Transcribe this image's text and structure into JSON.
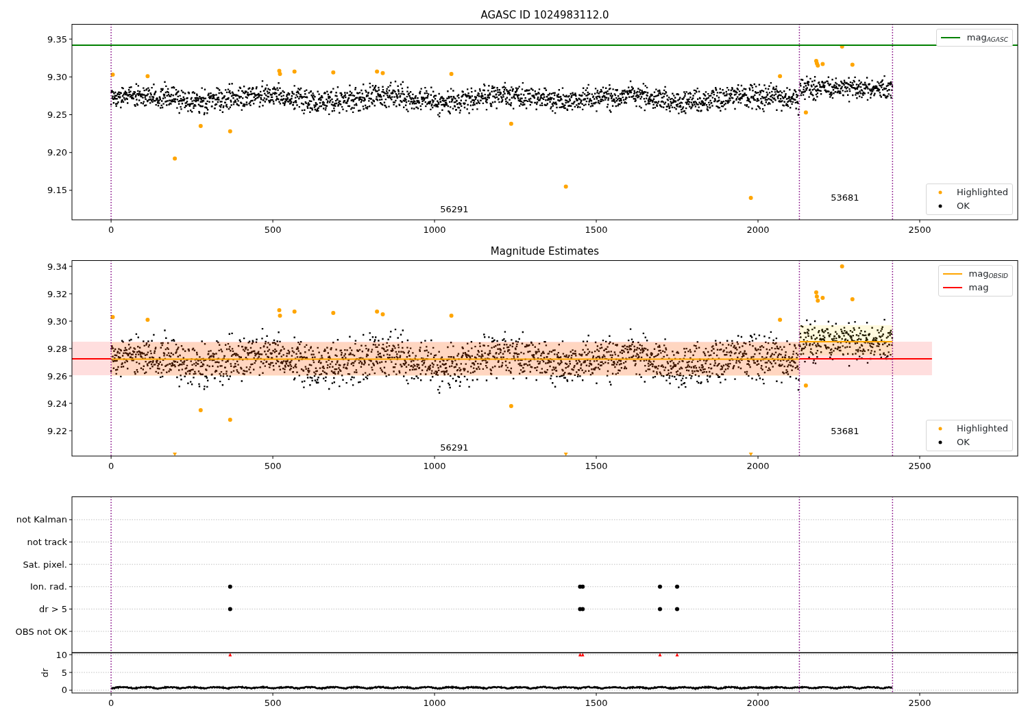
{
  "figure": {
    "panels": [
      {
        "title": "AGASC ID 1024983112.0",
        "legends": [
          {
            "items": [
              {
                "label": "mag$_{AGASC}$",
                "kind": "line",
                "color": "#008000"
              }
            ]
          },
          {
            "items": [
              {
                "label": "Highlighted",
                "kind": "dot",
                "color": "#ffa500"
              },
              {
                "label": "OK",
                "kind": "dot",
                "color": "#000000"
              }
            ]
          }
        ],
        "chart_data": {
          "type": "scatter",
          "xlim": [
            -121,
            2803
          ],
          "ylim": [
            9.111,
            9.37
          ],
          "xticks": [
            0,
            500,
            1000,
            1500,
            2000,
            2500
          ],
          "yticks": [
            {
              "value": 9.15,
              "label": "9.15"
            },
            {
              "value": 9.2,
              "label": "9.20"
            },
            {
              "value": 9.25,
              "label": "9.25"
            },
            {
              "value": 9.3,
              "label": "9.30"
            },
            {
              "value": 9.35,
              "label": "9.35"
            }
          ],
          "x": [
            5,
            113,
            197,
            277,
            368,
            520,
            522,
            567,
            687,
            822,
            840,
            1052,
            1237,
            1406,
            1978,
            2068,
            2148,
            2180,
            2182,
            2185,
            2200,
            2260,
            2292
          ],
          "series": [
            {
              "type": "scatter",
              "color": "#ffa500",
              "values": [
                9.303,
                9.301,
                9.192,
                9.235,
                9.228,
                9.308,
                9.304,
                9.307,
                9.306,
                9.307,
                9.305,
                9.304,
                9.238,
                9.155,
                9.14,
                9.301,
                9.253,
                9.321,
                9.318,
                9.315,
                9.317,
                9.34,
                9.316
              ]
            }
          ],
          "ref_lines": [
            {
              "axis": "y",
              "value": 9.342,
              "color": "#008000"
            },
            {
              "axis": "x",
              "value": 0,
              "color": "#800080"
            },
            {
              "axis": "x",
              "value": 2128,
              "color": "#800080"
            },
            {
              "axis": "x",
              "value": 2416,
              "color": "#800080"
            }
          ],
          "annotations": [
            "56291",
            "53681"
          ]
        }
      },
      {
        "title": "Magnitude Estimates",
        "legends": [
          {
            "items": [
              {
                "label": "mag$_{OBSID}$",
                "kind": "line",
                "color": "#ffa500"
              },
              {
                "label": "mag",
                "kind": "line",
                "color": "#ff0000"
              }
            ]
          },
          {
            "items": [
              {
                "label": "Highlighted",
                "kind": "dot",
                "color": "#ffa500"
              },
              {
                "label": "OK",
                "kind": "dot",
                "color": "#000000"
              }
            ]
          }
        ],
        "chart_data": {
          "type": "scatter",
          "xlim": [
            -121,
            2803
          ],
          "ylim": [
            9.2015,
            9.3445
          ],
          "xticks": [
            0,
            500,
            1000,
            1500,
            2000,
            2500
          ],
          "yticks": [
            {
              "value": 9.22,
              "label": "9.22"
            },
            {
              "value": 9.24,
              "label": "9.24"
            },
            {
              "value": 9.26,
              "label": "9.26"
            },
            {
              "value": 9.28,
              "label": "9.28"
            },
            {
              "value": 9.3,
              "label": "9.30"
            },
            {
              "value": 9.32,
              "label": "9.32"
            },
            {
              "value": 9.34,
              "label": "9.34"
            }
          ],
          "x": [
            -121,
            0,
            5,
            113,
            197,
            277,
            368,
            520,
            522,
            567,
            687,
            822,
            840,
            1052,
            1237,
            1406,
            1978,
            2068,
            2128,
            2148,
            2180,
            2182,
            2185,
            2200,
            2260,
            2292,
            2416,
            2538
          ],
          "series": [
            {
              "type": "line",
              "color": "#ff0000",
              "values": [
                9.2725,
                9.2725,
                null,
                null,
                null,
                null,
                null,
                null,
                null,
                null,
                null,
                null,
                null,
                null,
                null,
                null,
                null,
                null,
                9.2725,
                9.2725,
                9.2725,
                9.2725,
                9.2725,
                9.2725,
                9.2725,
                9.2725,
                9.2725,
                9.2725
              ]
            },
            {
              "type": "line",
              "color": "#ffa500",
              "values": [
                null,
                9.2722,
                9.2722,
                9.2722,
                9.2722,
                9.2722,
                9.2722,
                9.2722,
                9.2722,
                9.2722,
                9.2722,
                9.2722,
                9.2722,
                9.2722,
                9.2722,
                9.2722,
                9.2722,
                9.2722,
                9.2722,
                null,
                null,
                null,
                null,
                null,
                null,
                null,
                null,
                null
              ]
            },
            {
              "type": "line",
              "color": "#ffa500",
              "values": [
                null,
                null,
                null,
                null,
                null,
                null,
                null,
                null,
                null,
                null,
                null,
                null,
                null,
                null,
                null,
                null,
                null,
                null,
                9.285,
                9.285,
                9.285,
                9.285,
                9.285,
                9.285,
                9.285,
                9.285,
                9.285,
                null
              ]
            },
            {
              "type": "scatter",
              "color": "#ffa500",
              "values": [
                null,
                null,
                9.303,
                9.301,
                null,
                9.235,
                9.228,
                9.308,
                9.304,
                9.307,
                9.306,
                9.307,
                9.305,
                9.304,
                9.238,
                null,
                null,
                9.301,
                null,
                9.253,
                9.321,
                9.318,
                9.315,
                9.317,
                9.34,
                9.316,
                null,
                null
              ]
            },
            {
              "type": "scatter",
              "color": "#ffa500",
              "values": [
                null,
                null,
                null,
                null,
                9.2025,
                null,
                null,
                null,
                null,
                null,
                null,
                null,
                null,
                null,
                null,
                9.2025,
                9.2025,
                null,
                null,
                null,
                null,
                null,
                null,
                null,
                null,
                null,
                null,
                null
              ]
            }
          ],
          "bands": [
            {
              "axis": "y",
              "from": 9.2605,
              "to": 9.285,
              "color": "#ff0000"
            },
            {
              "axis": "y",
              "from": 9.26,
              "to": 9.2845,
              "color": "#ffa500"
            },
            {
              "axis": "y",
              "from": 9.275,
              "to": 9.297,
              "color": "#ffd700"
            }
          ],
          "ref_lines": [
            {
              "axis": "x",
              "value": 0,
              "color": "#800080"
            },
            {
              "axis": "x",
              "value": 2128,
              "color": "#800080"
            },
            {
              "axis": "x",
              "value": 2416,
              "color": "#800080"
            }
          ],
          "annotations": [
            "56291",
            "53681"
          ]
        }
      },
      {
        "chart_data": {
          "type": "scatter",
          "grid": true,
          "orientation": "horizontal",
          "xlim": [
            -121,
            2803
          ],
          "categories": [
            "not Kalman",
            "not track",
            "Sat. pixel.",
            "Ion. rad.",
            "dr > 5",
            "OBS not OK"
          ],
          "series": [
            {
              "color": "#000000",
              "values": [
                null,
                null,
                null,
                368,
                368,
                null
              ]
            },
            {
              "color": "#000000",
              "values": [
                null,
                null,
                null,
                1450,
                1450,
                null
              ]
            },
            {
              "color": "#000000",
              "values": [
                null,
                null,
                null,
                1458,
                1458,
                null
              ]
            },
            {
              "color": "#000000",
              "values": [
                null,
                null,
                null,
                1697,
                1697,
                null
              ]
            },
            {
              "color": "#000000",
              "values": [
                null,
                null,
                null,
                1750,
                1750,
                null
              ]
            }
          ],
          "ref_lines": [
            {
              "axis": "x",
              "value": 0,
              "color": "#800080"
            },
            {
              "axis": "x",
              "value": 2128,
              "color": "#800080"
            },
            {
              "axis": "x",
              "value": 2416,
              "color": "#800080"
            }
          ]
        }
      },
      {
        "chart_data": {
          "type": "scatter",
          "grid": true,
          "ylabel": "dr",
          "xlim": [
            -121,
            2803
          ],
          "ylim": [
            -0.77,
            10.58
          ],
          "xticks": [
            0,
            500,
            1000,
            1500,
            2000,
            2500
          ],
          "yticks": [
            0,
            5,
            10
          ],
          "x": [
            368,
            1450,
            1458,
            1697,
            1750
          ],
          "series": [
            {
              "type": "scatter",
              "color": "#ff0000",
              "values": [
                10,
                10,
                10,
                10,
                10
              ]
            }
          ],
          "ref_lines": [
            {
              "axis": "x",
              "value": 0,
              "color": "#800080"
            },
            {
              "axis": "x",
              "value": 2128,
              "color": "#800080"
            },
            {
              "axis": "x",
              "value": 2416,
              "color": "#800080"
            }
          ]
        }
      }
    ]
  }
}
